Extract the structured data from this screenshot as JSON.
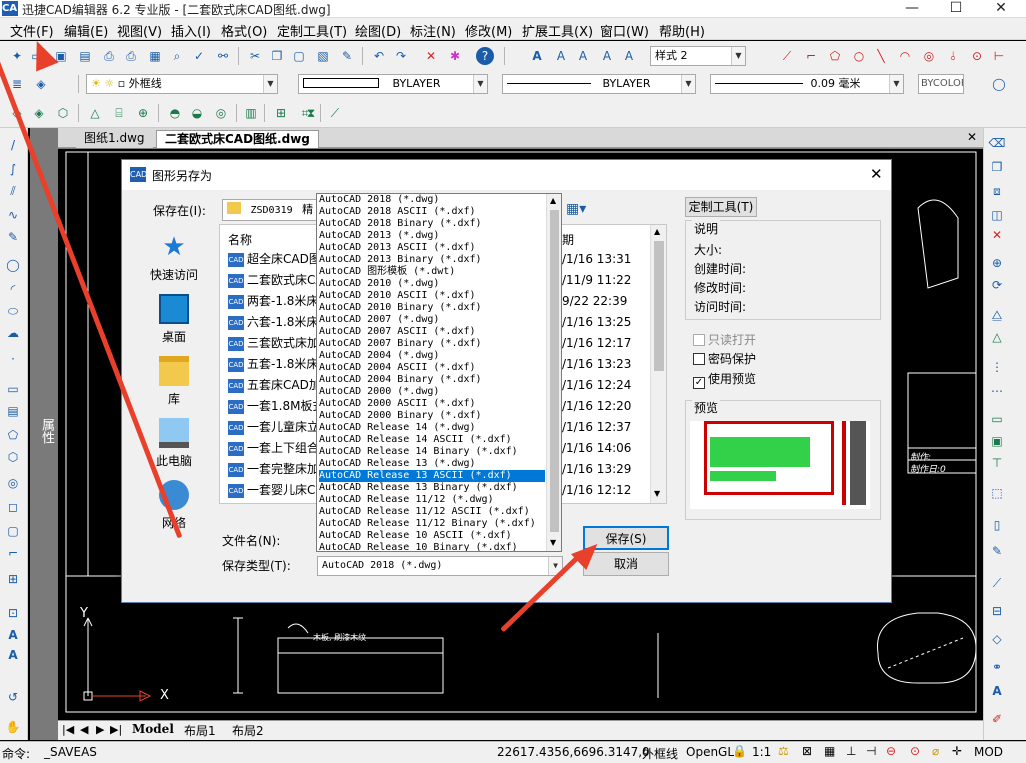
{
  "window": {
    "app_icon": "CAD",
    "title": "迅捷CAD编辑器 6.2 专业版 - [二套欧式床CAD图纸.dwg]",
    "minimize": "—",
    "maximize": "☐",
    "close": "✕"
  },
  "menu": [
    "文件(F)",
    "编辑(E)",
    "视图(V)",
    "插入(I)",
    "格式(O)",
    "定制工具(T)",
    "绘图(D)",
    "标注(N)",
    "修改(M)",
    "扩展工具(X)",
    "窗口(W)",
    "帮助(H)"
  ],
  "toolbar": {
    "style_combo": "样式 2",
    "layer_combo": "外框线",
    "linetype_combo": "BYLAYER",
    "lineweight_combo": "BYLAYER",
    "thickness_combo": "0.09 毫米",
    "color_combo": "BYCOLOR"
  },
  "doc_tabs": [
    "图纸1.dwg",
    "二套欧式床CAD图纸.dwg"
  ],
  "property_panel_label": "属性",
  "layout_tabs": [
    "Model",
    "布局1",
    "布局2"
  ],
  "status": {
    "command_label": "命令:",
    "command_value": "_SAVEAS",
    "coords": "22617.4356,6696.3147,0",
    "layer": "外框线",
    "render": "OpenGL",
    "scale": "1:1",
    "mode": "MOD"
  },
  "dialog": {
    "title": "图形另存为",
    "save_in_label": "保存在(I):",
    "save_in_value": "ZSD0319",
    "save_in_extra": "精",
    "places": [
      "快速访问",
      "桌面",
      "库",
      "此电脑",
      "网络"
    ],
    "columns": {
      "name": "名称",
      "date": "日期"
    },
    "files": [
      {
        "name": "超全床CAD图",
        "date": "/1/16 13:31"
      },
      {
        "name": "二套欧式床CA",
        "date": "/11/9 11:22"
      },
      {
        "name": "两套-1.8米床",
        "date": "9/22 22:39"
      },
      {
        "name": "六套-1.8米床",
        "date": "/1/16 13:25"
      },
      {
        "name": "三套欧式床加",
        "date": "/1/16 12:17"
      },
      {
        "name": "五套-1.8米床",
        "date": "/1/16 13:23"
      },
      {
        "name": "五套床CAD加",
        "date": "/1/16 12:24"
      },
      {
        "name": "一套1.8M板式",
        "date": "/1/16 12:20"
      },
      {
        "name": "一套儿童床立",
        "date": "/1/16 12:37"
      },
      {
        "name": "一套上下组合",
        "date": "/1/16 14:06"
      },
      {
        "name": "一套完整床加",
        "date": "/1/16 13:29"
      },
      {
        "name": "一套婴儿床C",
        "date": "/1/16 12:12"
      }
    ],
    "filename_label": "文件名(N):",
    "filetype_label": "保存类型(T):",
    "filetype_value": "AutoCAD 2018 (*.dwg)",
    "save_button": "保存(S)",
    "cancel_button": "取消",
    "custom_tools": "定制工具(T)",
    "info_title": "说明",
    "info_fields": [
      "大小:",
      "创建时间:",
      "修改时间:",
      "访问时间:"
    ],
    "readonly": "只读打开",
    "password": "密码保护",
    "use_preview": "使用预览",
    "preview_label": "预览",
    "checked_mark": "✓"
  },
  "filetype_options": [
    "AutoCAD 2018 (*.dwg)",
    "AutoCAD 2018 ASCII (*.dxf)",
    "AutoCAD 2018 Binary (*.dxf)",
    "AutoCAD 2013 (*.dwg)",
    "AutoCAD 2013 ASCII (*.dxf)",
    "AutoCAD 2013 Binary (*.dxf)",
    "AutoCAD 图形模板 (*.dwt)",
    "AutoCAD 2010 (*.dwg)",
    "AutoCAD 2010 ASCII (*.dxf)",
    "AutoCAD 2010 Binary (*.dxf)",
    "AutoCAD 2007 (*.dwg)",
    "AutoCAD 2007 ASCII (*.dxf)",
    "AutoCAD 2007 Binary (*.dxf)",
    "AutoCAD 2004 (*.dwg)",
    "AutoCAD 2004 ASCII (*.dxf)",
    "AutoCAD 2004 Binary (*.dxf)",
    "AutoCAD 2000 (*.dwg)",
    "AutoCAD 2000 ASCII (*.dxf)",
    "AutoCAD 2000 Binary (*.dxf)",
    "AutoCAD Release 14 (*.dwg)",
    "AutoCAD Release 14 ASCII (*.dxf)",
    "AutoCAD Release 14 Binary (*.dxf)",
    "AutoCAD Release 13 (*.dwg)",
    "AutoCAD Release 13 ASCII (*.dxf)",
    "AutoCAD Release 13 Binary (*.dxf)",
    "AutoCAD Release 11/12 (*.dwg)",
    "AutoCAD Release 11/12 ASCII (*.dxf)",
    "AutoCAD Release 11/12 Binary (*.dxf)",
    "AutoCAD Release 10 ASCII (*.dxf)",
    "AutoCAD Release 10 Binary (*.dxf)"
  ],
  "selected_filetype_index": 23,
  "canvas_labels": {
    "axis_y": "Y",
    "axis_x": "X",
    "note_right": "制作:",
    "note_right2": "制作日:0",
    "note_bottom": "木板, 刷漆木纹"
  },
  "colors": {
    "accent": "#0078d7",
    "arrow": "#e8402a",
    "canvas": "#000000",
    "drawing_line": "#ffffff"
  }
}
